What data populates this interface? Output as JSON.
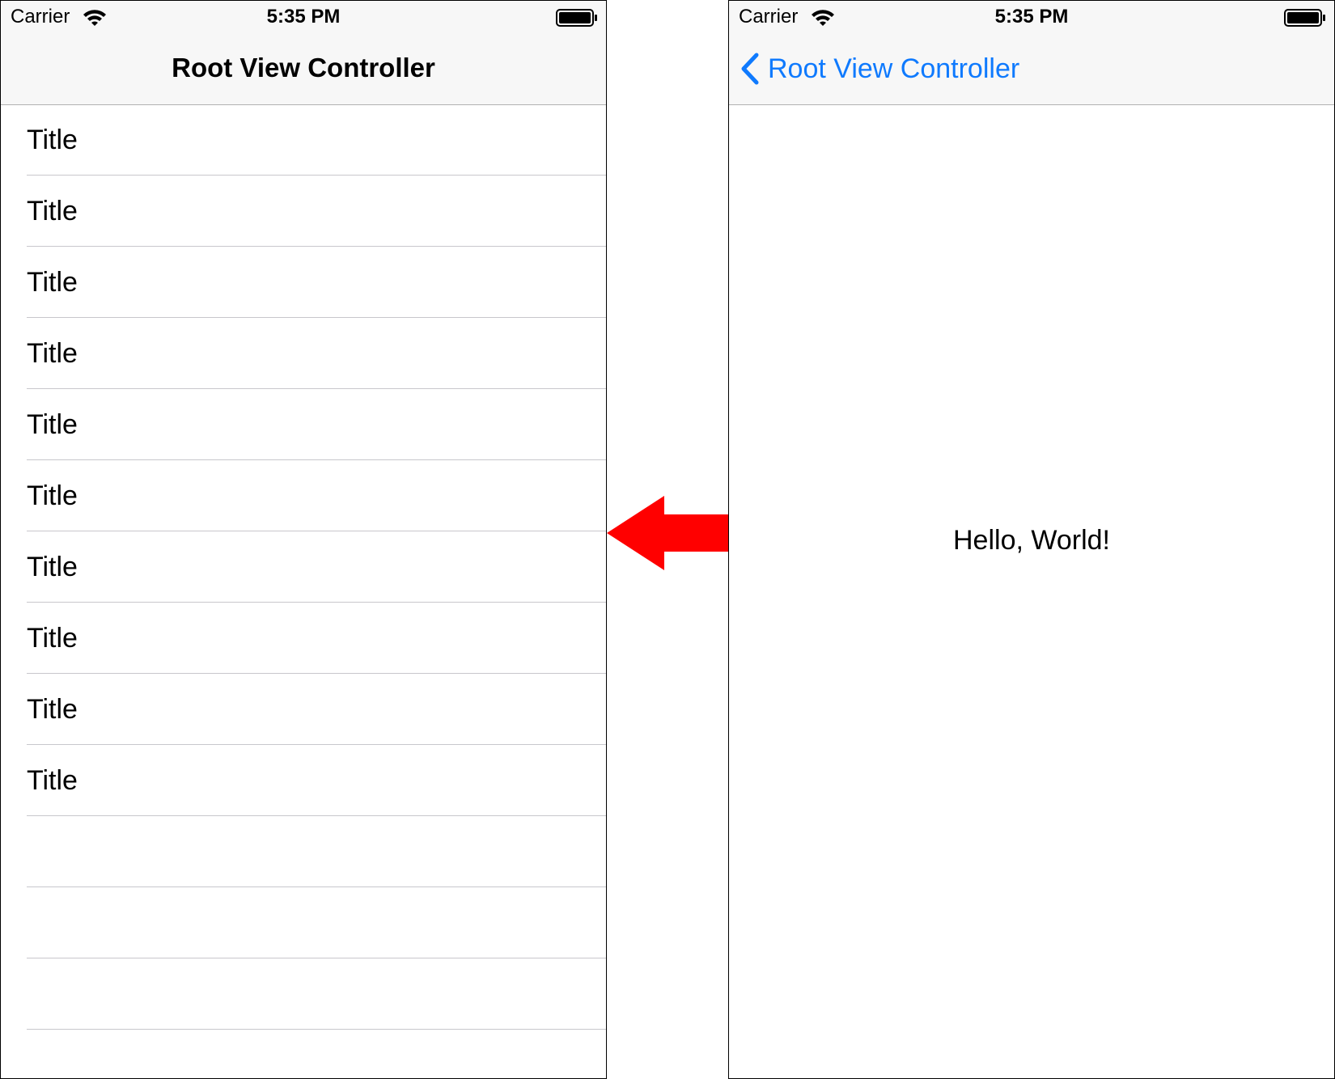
{
  "status_bar": {
    "carrier": "Carrier",
    "time": "5:35 PM"
  },
  "left_screen": {
    "nav_title": "Root View Controller",
    "rows": [
      "Title",
      "Title",
      "Title",
      "Title",
      "Title",
      "Title",
      "Title",
      "Title",
      "Title",
      "Title",
      "",
      "",
      "",
      ""
    ]
  },
  "right_screen": {
    "back_label": "Root View Controller",
    "content_text": "Hello, World!"
  },
  "colors": {
    "nav_background": "#f7f7f7",
    "tint": "#0f7afe",
    "separator": "#c8c7cc",
    "arrow": "#ff0000"
  },
  "icons": {
    "status": [
      "wifi-icon",
      "battery-icon"
    ],
    "back": "chevron-left-icon",
    "transition": "arrow-left-icon"
  }
}
